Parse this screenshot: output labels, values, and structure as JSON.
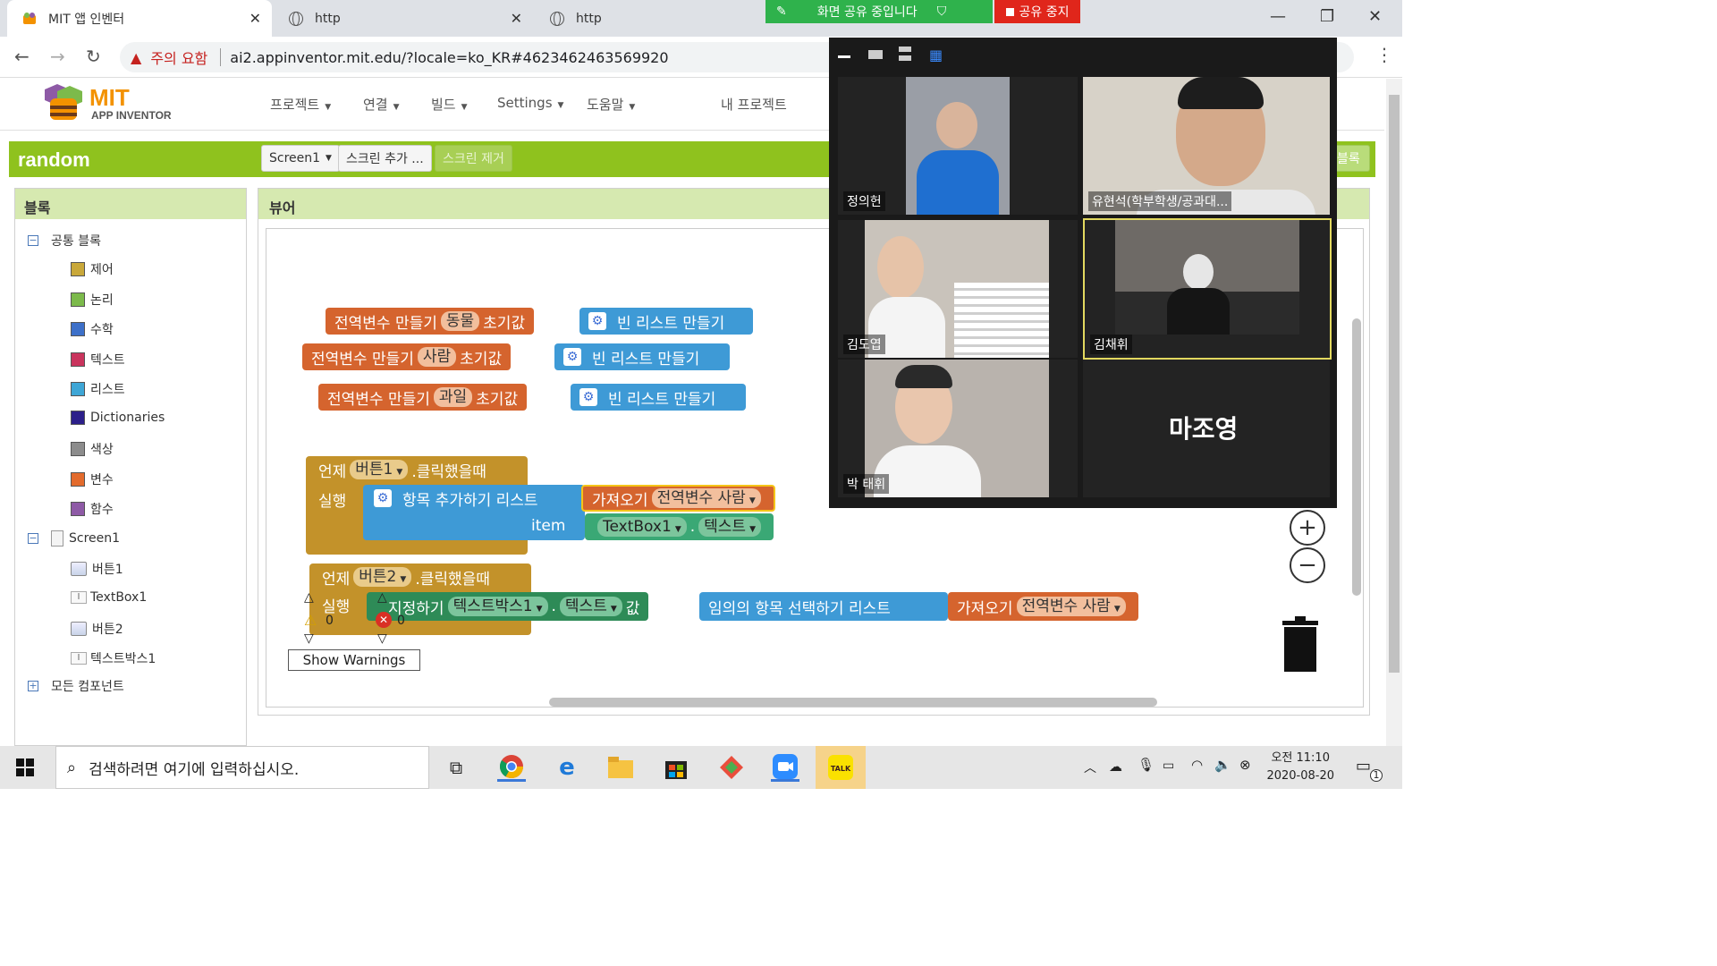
{
  "browser": {
    "tabs": [
      {
        "title": "MIT 앱 인벤터"
      },
      {
        "title": "http"
      },
      {
        "title": "http"
      }
    ],
    "warning_text": "주의 요함",
    "url": "ai2.appinventor.mit.edu/?locale=ko_KR#4623462463569920"
  },
  "share": {
    "status": "화면 공유 중입니다",
    "stop": "공유 중지"
  },
  "appinventor": {
    "logo_mit": "MIT",
    "logo_sub": "APP INVENTOR",
    "menu": [
      "프로젝트",
      "연결",
      "빌드",
      "Settings",
      "도움말"
    ],
    "my_projects": "내 프로젝트",
    "project_name": "random",
    "screen_select": "Screen1",
    "add_screen": "스크린 추가 ...",
    "remove_screen": "스크린 제거",
    "blocks_btn": "블록"
  },
  "palette": {
    "header": "블록",
    "builtin": "공통 블록",
    "categories": [
      {
        "label": "제어",
        "color": "#c9a83a"
      },
      {
        "label": "논리",
        "color": "#7cba4b"
      },
      {
        "label": "수학",
        "color": "#3d70c9"
      },
      {
        "label": "텍스트",
        "color": "#c9345d"
      },
      {
        "label": "리스트",
        "color": "#3ea6d6"
      },
      {
        "label": "Dictionaries",
        "color": "#2c1f8a"
      },
      {
        "label": "색상",
        "color": "#8c8c8c"
      },
      {
        "label": "변수",
        "color": "#e36b2d"
      },
      {
        "label": "함수",
        "color": "#8e5aa6"
      }
    ],
    "screen": "Screen1",
    "components": [
      "버튼1",
      "TextBox1",
      "버튼2",
      "텍스트박스1"
    ],
    "all_components": "모든 컴포넌트"
  },
  "viewer": {
    "header": "뷰어",
    "globals": [
      {
        "prefix": "전역변수 만들기",
        "name": "동물",
        "suffix": "초기값",
        "value": "빈 리스트 만들기"
      },
      {
        "prefix": "전역변수 만들기",
        "name": "사람",
        "suffix": "초기값",
        "value": "빈 리스트 만들기"
      },
      {
        "prefix": "전역변수 만들기",
        "name": "과일",
        "suffix": "초기값",
        "value": "빈 리스트 만들기"
      }
    ],
    "event1": {
      "when": "언제",
      "component": "버튼1",
      "event": ".클릭했을때",
      "do": "실행",
      "action": "항목 추가하기  리스트",
      "get": "가져오기",
      "get_var": "전역변수 사람",
      "item_label": "item",
      "textbox": "TextBox1",
      "prop": "텍스트"
    },
    "event2": {
      "when": "언제",
      "component": "버튼2",
      "event": ".클릭했을때",
      "do": "실행",
      "set": "지정하기",
      "target": "텍스트박스1",
      "prop": "텍스트",
      "value_label": "값",
      "pick": "임의의 항목 선택하기  리스트",
      "get": "가져오기",
      "get_var": "전역변수 사람"
    },
    "warnings_count": "0",
    "errors_count": "0",
    "show_warnings": "Show Warnings"
  },
  "zoom_call": {
    "participants": [
      "정의헌",
      "유현석(학부학생/공과대...",
      "김도엽",
      "김채휘",
      "박 태휘"
    ],
    "no_video": "마조영"
  },
  "taskbar": {
    "search_placeholder": "검색하려면 여기에 입력하십시오.",
    "time": "오전 11:10",
    "date": "2020-08-20",
    "notification_count": "1"
  }
}
